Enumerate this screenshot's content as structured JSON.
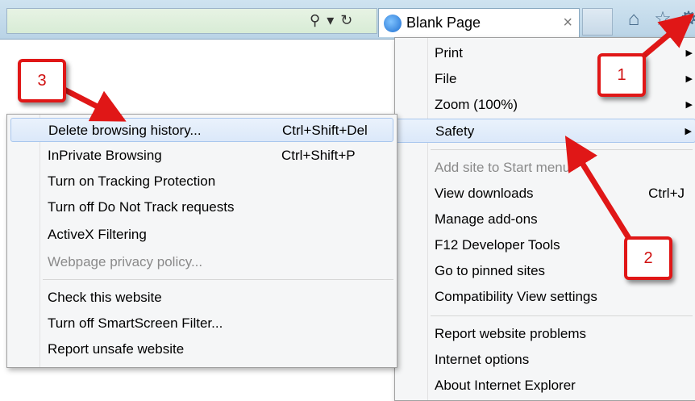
{
  "browser": {
    "tab_title": "Blank Page",
    "tab_close": "×"
  },
  "tools_menu": {
    "items": [
      {
        "label": "Print",
        "submenu": true
      },
      {
        "label": "File",
        "submenu": true
      },
      {
        "label": "Zoom (100%)",
        "submenu": true
      },
      {
        "label": "Safety",
        "submenu": true,
        "highlighted": true
      },
      {
        "label": "Add site to Start menu",
        "disabled": true
      },
      {
        "label": "View downloads",
        "shortcut": "Ctrl+J"
      },
      {
        "label": "Manage add-ons"
      },
      {
        "label": "F12 Developer Tools"
      },
      {
        "label": "Go to pinned sites"
      },
      {
        "label": "Compatibility View settings"
      },
      {
        "label": "Report website problems"
      },
      {
        "label": "Internet options"
      },
      {
        "label": "About Internet Explorer"
      }
    ]
  },
  "safety_menu": {
    "items": [
      {
        "label": "Delete browsing history...",
        "shortcut": "Ctrl+Shift+Del",
        "highlighted": true
      },
      {
        "label": "InPrivate Browsing",
        "shortcut": "Ctrl+Shift+P"
      },
      {
        "label": "Turn on Tracking Protection"
      },
      {
        "label": "Turn off Do Not Track requests"
      },
      {
        "label": "ActiveX Filtering"
      },
      {
        "label": "Webpage privacy policy...",
        "disabled": true
      },
      {
        "label": "Check this website"
      },
      {
        "label": "Turn off SmartScreen Filter..."
      },
      {
        "label": "Report unsafe website"
      }
    ]
  },
  "annotations": {
    "step1": "1",
    "step2": "2",
    "step3": "3"
  },
  "colors": {
    "annotation_red": "#e01717",
    "highlight_border": "#a8c6ee"
  }
}
